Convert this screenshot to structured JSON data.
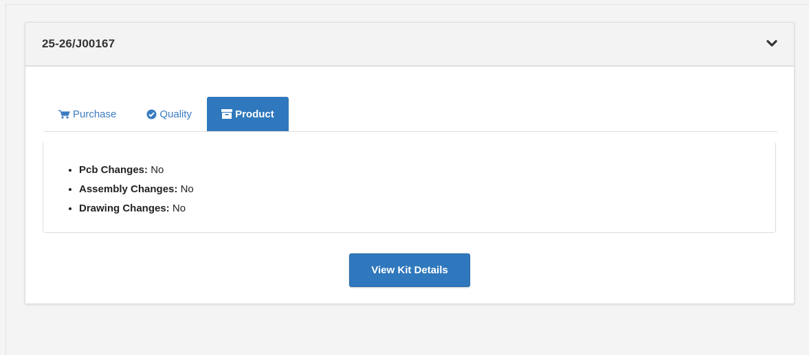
{
  "card": {
    "title": "25-26/J00167"
  },
  "tabs": [
    {
      "label": "Purchase",
      "icon": "cart-icon",
      "active": false
    },
    {
      "label": "Quality",
      "icon": "check-circle-icon",
      "active": false
    },
    {
      "label": "Product",
      "icon": "archive-box-icon",
      "active": true
    }
  ],
  "product_details": [
    {
      "label": "Pcb Changes:",
      "value": "No"
    },
    {
      "label": "Assembly Changes:",
      "value": "No"
    },
    {
      "label": "Drawing Changes:",
      "value": "No"
    }
  ],
  "actions": {
    "view_kit_label": "View Kit Details"
  },
  "colors": {
    "accent": "#2f78bd",
    "link": "#3a7bc0",
    "header_bg": "#f3f3f3"
  }
}
